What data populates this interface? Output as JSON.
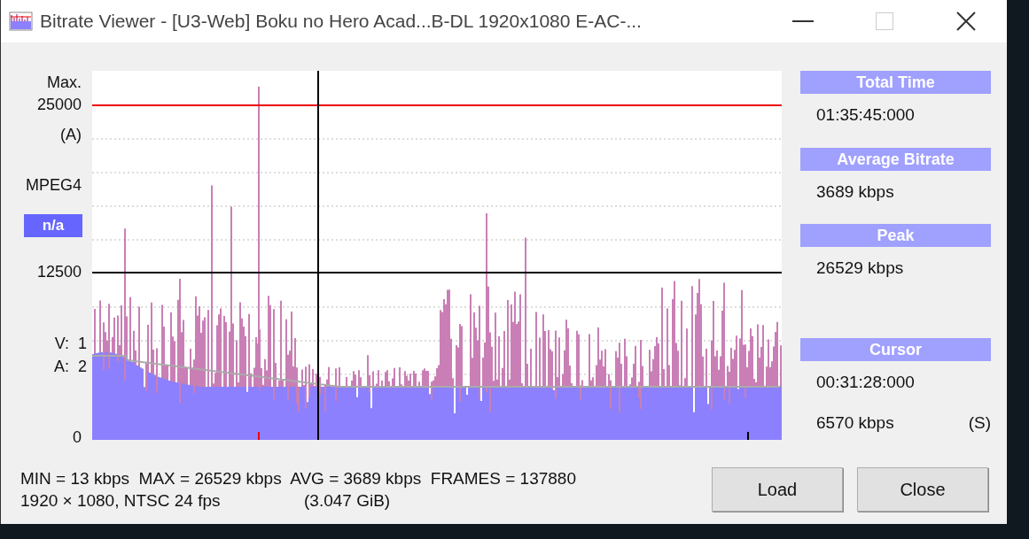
{
  "window": {
    "title": "Bitrate Viewer - [U3-Web] Boku no Hero Acad...B-DL 1920x1080 E-AC-..."
  },
  "axis_labels": [
    {
      "kind": "caption",
      "text": "Max."
    },
    {
      "kind": "value",
      "text": "25000"
    },
    {
      "kind": "caption",
      "text": "(A)"
    },
    {
      "kind": "caption",
      "text": "MPEG4"
    },
    {
      "kind": "badge",
      "text": "n/a"
    },
    {
      "kind": "value",
      "text": "12500"
    },
    {
      "kind": "track",
      "text": "V:  1"
    },
    {
      "kind": "track",
      "text": "A:  2"
    },
    {
      "kind": "value",
      "text": "0"
    }
  ],
  "info_panel": [
    {
      "heading": "Total Time",
      "lines": [
        {
          "text": "01:35:45:000"
        }
      ]
    },
    {
      "heading": "Average Bitrate",
      "lines": [
        {
          "text": "3689 kbps"
        }
      ]
    },
    {
      "heading": "Peak",
      "lines": [
        {
          "text": "26529 kbps"
        }
      ]
    },
    {
      "heading": "Cursor",
      "lines": [
        {
          "text": "00:31:28:000"
        },
        {
          "text": "6570 kbps",
          "mode": "(S)"
        }
      ]
    }
  ],
  "stats": {
    "summary": "MIN = 13 kbps  MAX = 26529 kbps  AVG = 3689 kbps  FRAMES = 137880",
    "video_info": "1920 × 1080, NTSC 24 fps",
    "file_size": "(3.047 GiB)"
  },
  "buttons": [
    "Load",
    "Close"
  ]
}
